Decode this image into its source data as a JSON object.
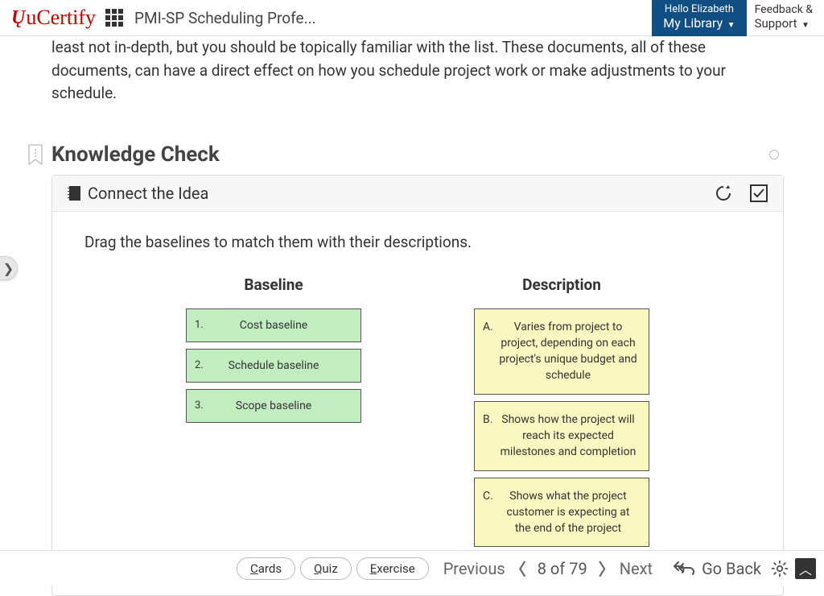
{
  "header": {
    "brand": "uCertify",
    "course_title": "PMI-SP Scheduling Profe...",
    "hello": "Hello Elizabeth",
    "my_library": "My Library",
    "feedback": "Feedback &",
    "support": "Support"
  },
  "intro_paragraph": "least not in-depth, but you should be topically familiar with the list. These documents, all of these documents, can have a direct effect on how you schedule project work or make adjustments to your schedule.",
  "section_title": "Knowledge Check",
  "card_title": "Connect the Idea",
  "instruction": "Drag the baselines to match them with their descriptions.",
  "columns": {
    "left": "Baseline",
    "right": "Description"
  },
  "baselines": [
    {
      "num": "1.",
      "label": "Cost baseline"
    },
    {
      "num": "2.",
      "label": "Schedule baseline"
    },
    {
      "num": "3.",
      "label": "Scope baseline"
    }
  ],
  "descriptions": [
    {
      "letter": "A.",
      "text": "Varies from project to project, depending on each project's unique budget and schedule"
    },
    {
      "letter": "B.",
      "text": "Shows how the project will reach its expected milestones and completion"
    },
    {
      "letter": "C.",
      "text": "Shows what the project customer is expecting at the end of the project"
    }
  ],
  "bottom": {
    "cards_key": "C",
    "cards_rest": "ards",
    "quiz_key": "Q",
    "quiz_rest": "uiz",
    "exercise_key": "E",
    "exercise_rest": "xercise",
    "previous": "Previous",
    "page_info": "8 of 79",
    "next": "Next",
    "go_back": "Go Back"
  }
}
